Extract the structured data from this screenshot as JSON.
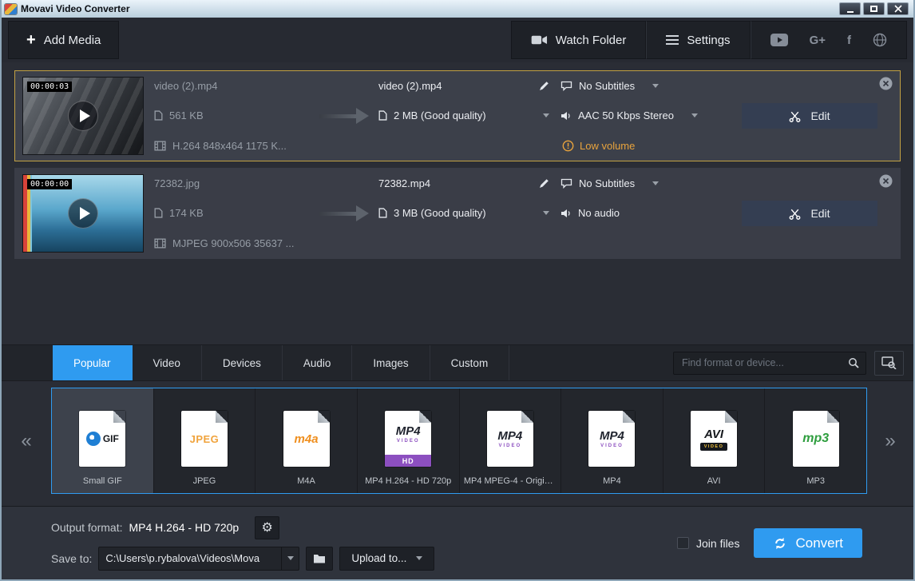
{
  "colors": {
    "accent": "#2f9bf0",
    "selected_row_border": "#c2a143",
    "warning": "#e8a33d"
  },
  "window": {
    "title": "Movavi Video Converter"
  },
  "toolbar": {
    "add_media_plus": "+",
    "add_media": "Add Media",
    "watch_folder": "Watch Folder",
    "settings": "Settings",
    "gplus": "G+",
    "facebook": "f"
  },
  "files": [
    {
      "timestamp": "00:00:03",
      "name": "video (2).mp4",
      "size": "561 KB",
      "codec": "H.264 848x464 1175 K...",
      "output_name": "video (2).mp4",
      "output_size": "2 MB (Good quality)",
      "subtitles": "No Subtitles",
      "audio": "AAC 50 Kbps Stereo",
      "warning": "Low volume",
      "edit": "Edit"
    },
    {
      "timestamp": "00:00:00",
      "name": "72382.jpg",
      "size": "174 KB",
      "codec": "MJPEG 900x506 35637 ...",
      "output_name": "72382.mp4",
      "output_size": "3 MB (Good quality)",
      "subtitles": "No Subtitles",
      "audio": "No audio",
      "edit": "Edit"
    }
  ],
  "tabs": [
    {
      "label": "Popular"
    },
    {
      "label": "Video"
    },
    {
      "label": "Devices"
    },
    {
      "label": "Audio"
    },
    {
      "label": "Images"
    },
    {
      "label": "Custom"
    }
  ],
  "search": {
    "placeholder": "Find format or device..."
  },
  "formats": [
    {
      "label": "Small GIF",
      "badge": "GIF"
    },
    {
      "label": "JPEG",
      "badge": "JPEG"
    },
    {
      "label": "M4A",
      "badge": "m4a"
    },
    {
      "label": "MP4 H.264 - HD 720p",
      "badge": "MP4",
      "sub": "VIDEO",
      "tag": "HD"
    },
    {
      "label": "MP4 MPEG-4 - Origin...",
      "badge": "MP4",
      "sub": "VIDEO"
    },
    {
      "label": "MP4",
      "badge": "MP4",
      "sub": "VIDEO"
    },
    {
      "label": "AVI",
      "badge": "AVI",
      "sub": "VIDEO"
    },
    {
      "label": "MP3",
      "badge": "mp3"
    }
  ],
  "footer": {
    "output_format_label": "Output format:",
    "output_format_value": "MP4 H.264 - HD 720p",
    "save_to_label": "Save to:",
    "save_to_value": "C:\\Users\\p.rybalova\\Videos\\Mova",
    "upload_to": "Upload to...",
    "join_files": "Join files",
    "convert": "Convert"
  },
  "icons": {
    "gear": "⚙",
    "prev": "«",
    "next": "»"
  }
}
